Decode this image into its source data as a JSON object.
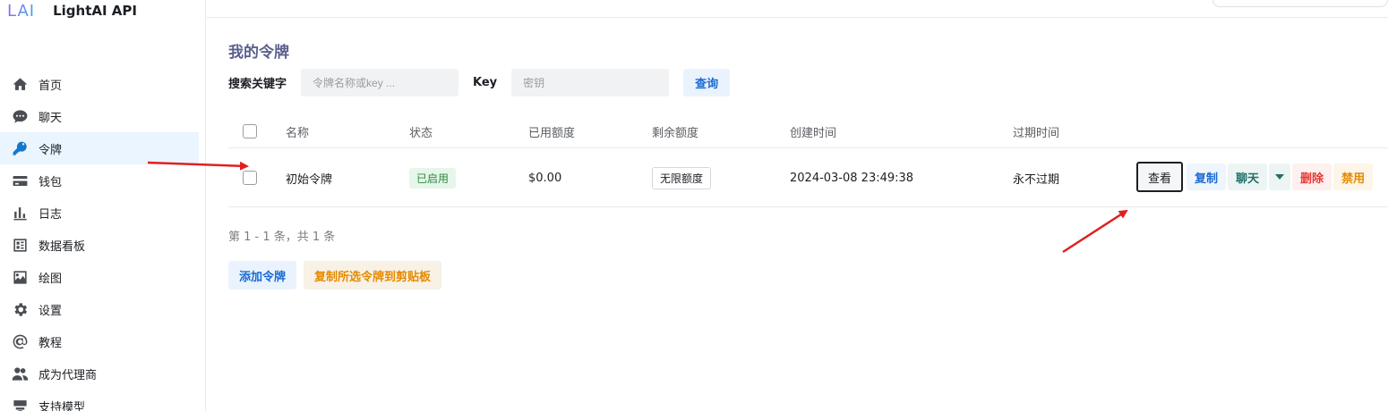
{
  "brand": {
    "logo": "LAI",
    "name": "LightAI API"
  },
  "sidebar": {
    "items": [
      {
        "label": "首页",
        "icon": "home-icon"
      },
      {
        "label": "聊天",
        "icon": "chat-bubble-icon"
      },
      {
        "label": "令牌",
        "icon": "key-icon",
        "active": true
      },
      {
        "label": "钱包",
        "icon": "credit-card-icon"
      },
      {
        "label": "日志",
        "icon": "bar-chart-icon"
      },
      {
        "label": "数据看板",
        "icon": "dashboard-icon"
      },
      {
        "label": "绘图",
        "icon": "image-icon"
      },
      {
        "label": "设置",
        "icon": "gear-icon"
      },
      {
        "label": "教程",
        "icon": "at-sign-icon"
      },
      {
        "label": "成为代理商",
        "icon": "users-icon"
      },
      {
        "label": "支持模型",
        "icon": "model-icon"
      }
    ]
  },
  "main": {
    "title": "我的令牌",
    "search": {
      "keyword_label": "搜索关键字",
      "keyword_placeholder": "令牌名称或key ...",
      "key_label": "Key",
      "key_placeholder": "密钥",
      "query_button": "查询"
    },
    "table": {
      "columns": [
        "名称",
        "状态",
        "已用额度",
        "剩余额度",
        "创建时间",
        "过期时间"
      ],
      "rows": [
        {
          "name": "初始令牌",
          "status": "已启用",
          "used": "$0.00",
          "remaining": "无限额度",
          "created": "2024-03-08 23:49:38",
          "expires": "永不过期"
        }
      ]
    },
    "row_actions": {
      "view": "查看",
      "copy": "复制",
      "chat": "聊天",
      "delete": "删除",
      "disable": "禁用"
    },
    "pagination": "第 1 - 1 条，共 1 条",
    "add_button": "添加令牌",
    "copy_selected_button": "复制所选令牌到剪贴板"
  },
  "colors": {
    "accent": "#1a6bd3",
    "active_bg": "#eaf5ff",
    "success": "#2b8a3e",
    "danger": "#e53935",
    "warning": "#e68a00",
    "annotation_arrow": "#e02020"
  }
}
